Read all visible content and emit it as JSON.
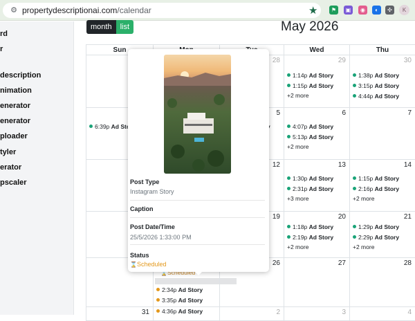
{
  "browser": {
    "url_host": "propertydescriptionai.com",
    "url_path": "/calendar",
    "profile_initial": "K"
  },
  "sidebar": {
    "items": [
      "rd",
      "r",
      "description",
      "nimation",
      "enerator",
      "enerator",
      "ploader",
      "tyler",
      "erator",
      "pscaler"
    ]
  },
  "toolbar": {
    "month_label": "month",
    "list_label": "list"
  },
  "calendar": {
    "title": "May 2026",
    "weekdays": [
      "Sun",
      "Mon",
      "Tue",
      "Wed",
      "Thu"
    ],
    "rows": [
      {
        "sun": "",
        "mon": "",
        "tue": "28",
        "wed": "29",
        "thu": "30",
        "wed_events": [
          [
            "1:14p",
            "Ad Story"
          ],
          [
            "1:15p",
            "Ad Story"
          ]
        ],
        "wed_more": "+2 more",
        "thu_events": [
          [
            "1:38p",
            "Ad Story"
          ],
          [
            "3:15p",
            "Ad Story"
          ],
          [
            "4:44p",
            "Ad Story"
          ]
        ]
      },
      {
        "tue": "5",
        "wed": "6",
        "thu": "7",
        "sun_events": [
          [
            "6:39p",
            "Ad Sto"
          ]
        ],
        "wed_events": [
          [
            "4:07p",
            "Ad Story"
          ],
          [
            "5:13p",
            "Ad Story"
          ]
        ],
        "wed_more": "+2 more"
      },
      {
        "tue": "12",
        "wed": "13",
        "thu": "14",
        "wed_events": [
          [
            "1:30p",
            "Ad Story"
          ],
          [
            "2:31p",
            "Ad Story"
          ]
        ],
        "wed_more": "+3 more",
        "thu_events": [
          [
            "1:15p",
            "Ad Story"
          ],
          [
            "2:16p",
            "Ad Story"
          ]
        ],
        "thu_more": "+2 more"
      },
      {
        "tue": "19",
        "wed": "20",
        "thu": "21",
        "wed_events": [
          [
            "1:18p",
            "Ad Story"
          ],
          [
            "2:19p",
            "Ad Story"
          ]
        ],
        "wed_more": "+2 more",
        "thu_events": [
          [
            "1:29p",
            "Ad Story"
          ],
          [
            "2:29p",
            "Ad Story"
          ]
        ],
        "thu_more": "+2 more"
      },
      {
        "tue": "26",
        "wed": "27",
        "thu": "28",
        "mon_events": [
          [
            "2:34p",
            "Ad Story"
          ],
          [
            "3:35p",
            "Ad Story"
          ],
          [
            "4:36p",
            "Ad Story"
          ]
        ],
        "mon_behind_text": "Scheduled"
      },
      {
        "sun": "31",
        "tue": "2",
        "wed": "3",
        "thu": "4"
      }
    ],
    "partial_event_text": "y"
  },
  "popover": {
    "post_type_label": "Post Type",
    "post_type_value": "Instagram Story",
    "caption_label": "Caption",
    "date_label": "Post Date/Time",
    "date_value": "25/5/2026 1:33:00 PM",
    "status_label": "Status",
    "status_value": "Scheduled"
  }
}
